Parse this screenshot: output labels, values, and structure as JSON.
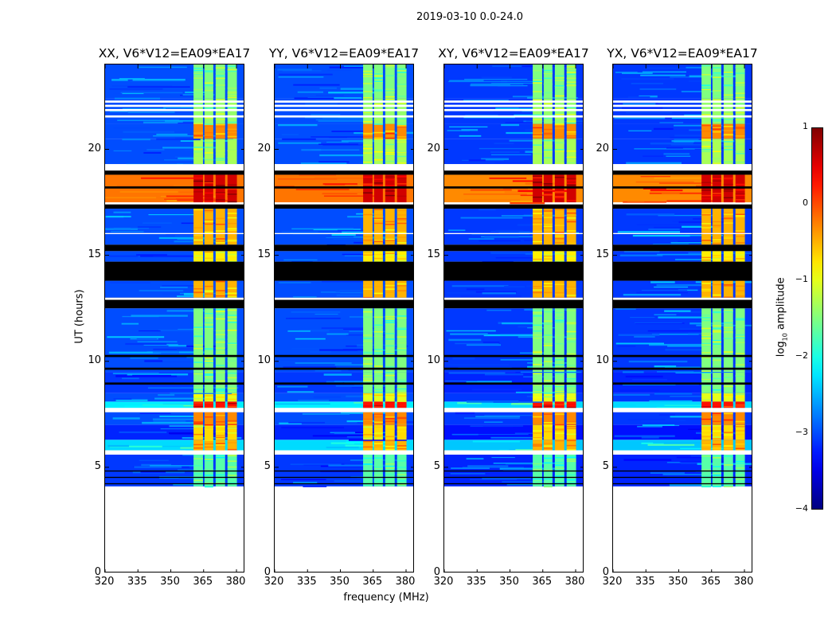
{
  "suptitle": "2019-03-10 0.0-24.0",
  "chart_data": {
    "type": "heatmap",
    "xlabel": "frequency (MHz)",
    "ylabel": "UT (hours)",
    "xlim": [
      320,
      384
    ],
    "ylim": [
      0,
      24
    ],
    "xticks": [
      "320",
      "335",
      "350",
      "365",
      "380"
    ],
    "xtick_values": [
      320,
      335,
      350,
      365,
      380
    ],
    "yticks": [
      "0",
      "5",
      "10",
      "15",
      "20"
    ],
    "ytick_values": [
      0,
      5,
      10,
      15,
      20
    ],
    "colorbar": {
      "label": "log10 amplitude",
      "label_main": "log",
      "label_sub": "10",
      "label_rest": " amplitude",
      "clim": [
        -4,
        1
      ],
      "ticks": [
        "1",
        "0",
        "−1",
        "−2",
        "−3",
        "−4"
      ],
      "tick_values": [
        1,
        0,
        -1,
        -2,
        -3,
        -4
      ],
      "colormap": "jet"
    },
    "rfi_bands_mhz": [
      [
        360.4,
        364.7
      ],
      [
        365.4,
        369.4
      ],
      [
        370.5,
        374.8
      ],
      [
        375.9,
        380.2
      ]
    ],
    "segments": [
      {
        "t": [
          4.1,
          5.6
        ],
        "base": -3.1,
        "band": -1.7
      },
      {
        "t": [
          5.8,
          6.3
        ],
        "base": -2.3,
        "band": -0.5
      },
      {
        "t": [
          6.3,
          7.0
        ],
        "base": -3.2,
        "band": -0.7
      },
      {
        "t": [
          7.0,
          7.6
        ],
        "base": -3.0,
        "band": -0.3
      },
      {
        "t": [
          7.8,
          8.1
        ],
        "base": -2.2,
        "band": 0.3
      },
      {
        "t": [
          8.1,
          8.5
        ],
        "base": -3.0,
        "band": -1.0
      },
      {
        "t": [
          8.5,
          9.5
        ],
        "base": -3.1,
        "band": -1.5
      },
      {
        "t": [
          9.5,
          12.5
        ],
        "base": -3.0,
        "band": -1.5
      },
      {
        "t": [
          13.0,
          13.8
        ],
        "base": -3.0,
        "band": -0.5
      },
      {
        "t": [
          14.7,
          15.2
        ],
        "base": -3.0,
        "band": -0.8
      },
      {
        "t": [
          15.5,
          17.2
        ],
        "base": -3.0,
        "band": -0.5
      },
      {
        "t": [
          17.5,
          18.8
        ],
        "base": -0.2,
        "band": 0.6
      },
      {
        "t": [
          19.3,
          20.5
        ],
        "base": -3.0,
        "band": -1.3
      },
      {
        "t": [
          20.5,
          21.2
        ],
        "base": -3.0,
        "band": -0.3
      },
      {
        "t": [
          21.2,
          22.4
        ],
        "base": -3.0,
        "band": -1.4
      },
      {
        "t": [
          22.4,
          24.0
        ],
        "base": -3.0,
        "band": -1.5
      }
    ],
    "flagged_black": [
      [
        4.2,
        4.25
      ],
      [
        4.5,
        4.55
      ],
      [
        4.8,
        4.85
      ],
      [
        8.9,
        9.0
      ],
      [
        9.6,
        9.7
      ],
      [
        10.2,
        10.3
      ],
      [
        12.5,
        13.0
      ],
      [
        13.8,
        14.7
      ],
      [
        15.2,
        15.5
      ],
      [
        17.2,
        17.4
      ],
      [
        18.8,
        19.0
      ],
      [
        18.15,
        18.25
      ]
    ],
    "flagged_white": [
      [
        5.6,
        5.8
      ],
      [
        7.6,
        7.8
      ],
      [
        19.0,
        19.3
      ],
      [
        21.5,
        21.6
      ],
      [
        21.8,
        21.9
      ],
      [
        22.0,
        22.1
      ],
      [
        22.2,
        22.3
      ],
      [
        12.9,
        13.0
      ],
      [
        16.0,
        16.05
      ]
    ],
    "panels": [
      {
        "title": "XX, V6*V12=EA09*EA17"
      },
      {
        "title": "YY, V6*V12=EA09*EA17"
      },
      {
        "title": "XY, V6*V12=EA09*EA17"
      },
      {
        "title": "YX, V6*V12=EA09*EA17"
      }
    ]
  }
}
